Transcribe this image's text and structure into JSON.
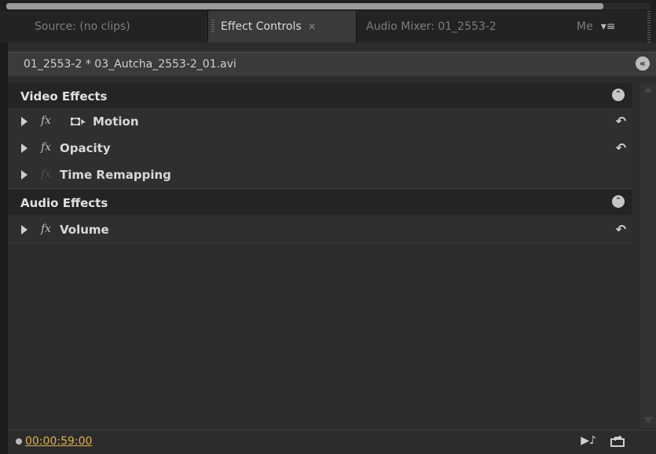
{
  "tabs": {
    "source": "Source: (no clips)",
    "effect_controls": "Effect Controls",
    "effect_controls_close": "×",
    "audio_mixer": "Audio Mixer: 01_2553-2",
    "metadata": "Me",
    "panel_menu": "▾≡"
  },
  "panel": {
    "clip_title": "01_2553-2 * 03_Autcha_2553-2_01.avi",
    "collapse_icon": "«"
  },
  "video_effects": {
    "label": "Video Effects",
    "toggle": "⌃",
    "items": [
      {
        "fx": "fx",
        "label": "Motion",
        "reset": "↶"
      },
      {
        "fx": "fx",
        "label": "Opacity",
        "reset": "↶"
      },
      {
        "fx": "fx",
        "label": "Time Remapping",
        "reset": ""
      }
    ]
  },
  "audio_effects": {
    "label": "Audio Effects",
    "toggle": "⌃",
    "items": [
      {
        "fx": "fx",
        "label": "Volume",
        "reset": "↶"
      }
    ]
  },
  "footer": {
    "timecode": "00:00:59:00",
    "play_audio_icon": "▶♪"
  }
}
